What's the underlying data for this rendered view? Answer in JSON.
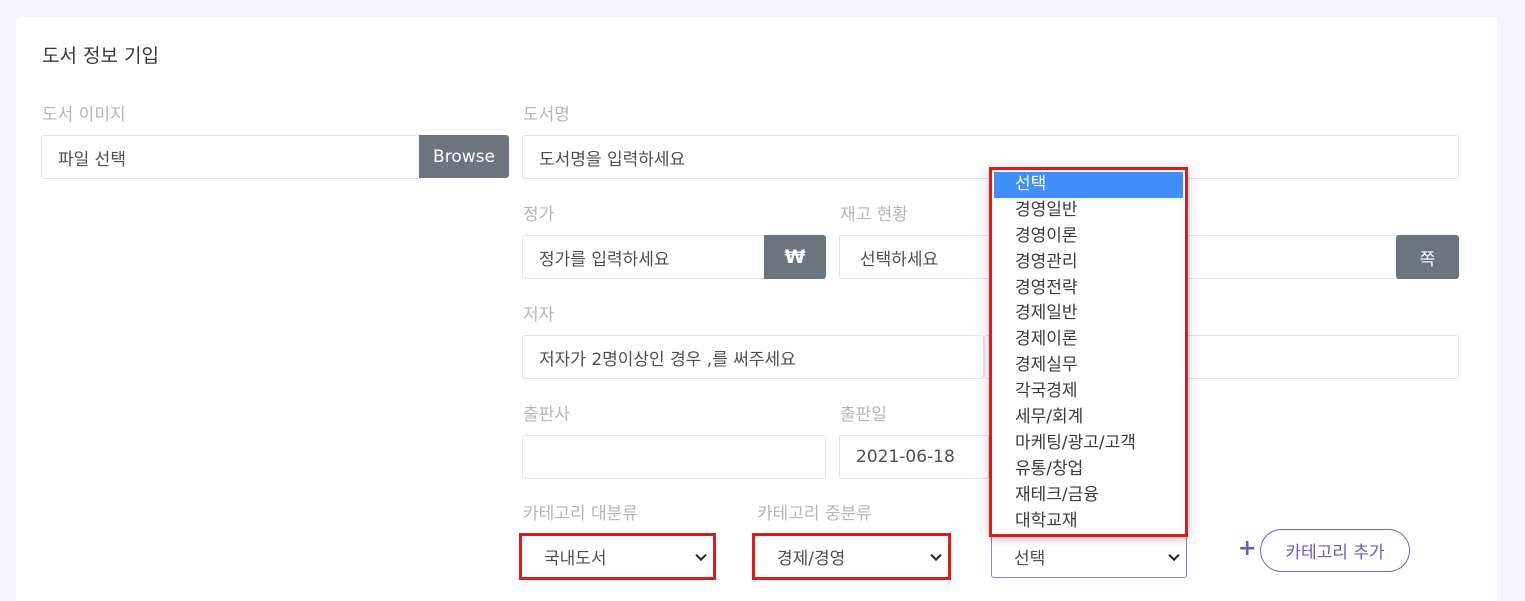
{
  "form": {
    "title": "도서 정보 기입",
    "image": {
      "label": "도서 이미지",
      "value": "파일 선택",
      "browse_label": "Browse"
    },
    "book_name": {
      "label": "도서명",
      "placeholder": "도서명을 입력하세요"
    },
    "price": {
      "label": "정가",
      "placeholder": "정가를 입력하세요",
      "unit": "₩"
    },
    "stock": {
      "label": "재고 현황",
      "value": "선택하세요"
    },
    "pages": {
      "unit": "쪽"
    },
    "author": {
      "label": "저자",
      "placeholder": "저자가 2명이상인 경우 ,를 써주세요"
    },
    "publisher": {
      "label": "출판사",
      "value": ""
    },
    "pub_date": {
      "label": "출판일",
      "value": "2021-06-18"
    },
    "category_major": {
      "label": "카테고리 대분류",
      "value": "국내도서"
    },
    "category_middle": {
      "label": "카테고리 중분류",
      "value": "경제/경영"
    },
    "category_minor": {
      "value": "선택"
    },
    "add_category": {
      "label": "카테고리 추가",
      "icon": "plus-icon"
    }
  },
  "dropdown": {
    "items": [
      "선택",
      "경영일반",
      "경영이론",
      "경영관리",
      "경영전략",
      "경제일반",
      "경제이론",
      "경제실무",
      "각국경제",
      "세무/회계",
      "마케팅/광고/고객",
      "유통/창업",
      "재테크/금융",
      "대학교재"
    ],
    "selected_index": 0
  },
  "colors": {
    "highlight_red": "#e3191c",
    "selected_blue": "#3f8efc",
    "accent_purple": "#6f57c0",
    "button_gray": "#6c757d"
  }
}
